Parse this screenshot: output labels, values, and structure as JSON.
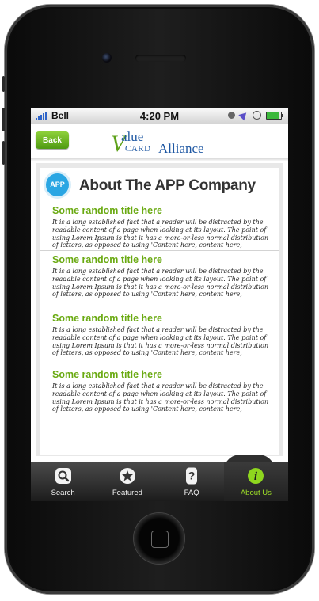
{
  "status_bar": {
    "carrier": "Bell",
    "time": "4:20 PM"
  },
  "header": {
    "back_label": "Back",
    "logo": {
      "letter_v": "V",
      "word_value": "alue",
      "word_card": "CARD",
      "word_alliance": "Alliance"
    }
  },
  "page": {
    "badge": "APP",
    "title": "About The APP Company"
  },
  "sections": [
    {
      "title": "Some random title here",
      "body": "It is a long established fact that a reader will be distracted by the readable content of a page when looking at its layout. The point of using Lorem Ipsum is that it has a more-or-less normal distribution of letters, as opposed to using 'Content here, content here,"
    },
    {
      "title": "Some random title here",
      "body": "It is a long established fact that a reader will be distracted by the readable content of a page when looking at its layout. The point of using Lorem Ipsum is that it has a more-or-less normal distribution of letters, as opposed to using 'Content here, content here,"
    },
    {
      "title": "Some random title here",
      "body": "It is a long established fact that a reader will be distracted by the readable content of a page when looking at its layout. The point of using Lorem Ipsum is that it has a more-or-less normal distribution of letters, as opposed to using 'Content here, content here,"
    },
    {
      "title": "Some random title here",
      "body": "It is a long established fact that a reader will be distracted by the readable content of a page when looking at its layout. The point of using Lorem Ipsum is that it has a more-or-less normal distribution of letters, as opposed to using 'Content here, content here,"
    }
  ],
  "tabs": [
    {
      "label": "Search",
      "icon": "search-icon",
      "active": false
    },
    {
      "label": "Featured",
      "icon": "star-icon",
      "active": false
    },
    {
      "label": "FAQ",
      "icon": "question-icon",
      "active": false
    },
    {
      "label": "About Us",
      "icon": "info-icon",
      "active": true
    }
  ],
  "colors": {
    "brand_green": "#6aaa12",
    "brand_blue": "#1f58a3",
    "badge_blue": "#2aa6e3",
    "active_tab": "#9fe027"
  }
}
